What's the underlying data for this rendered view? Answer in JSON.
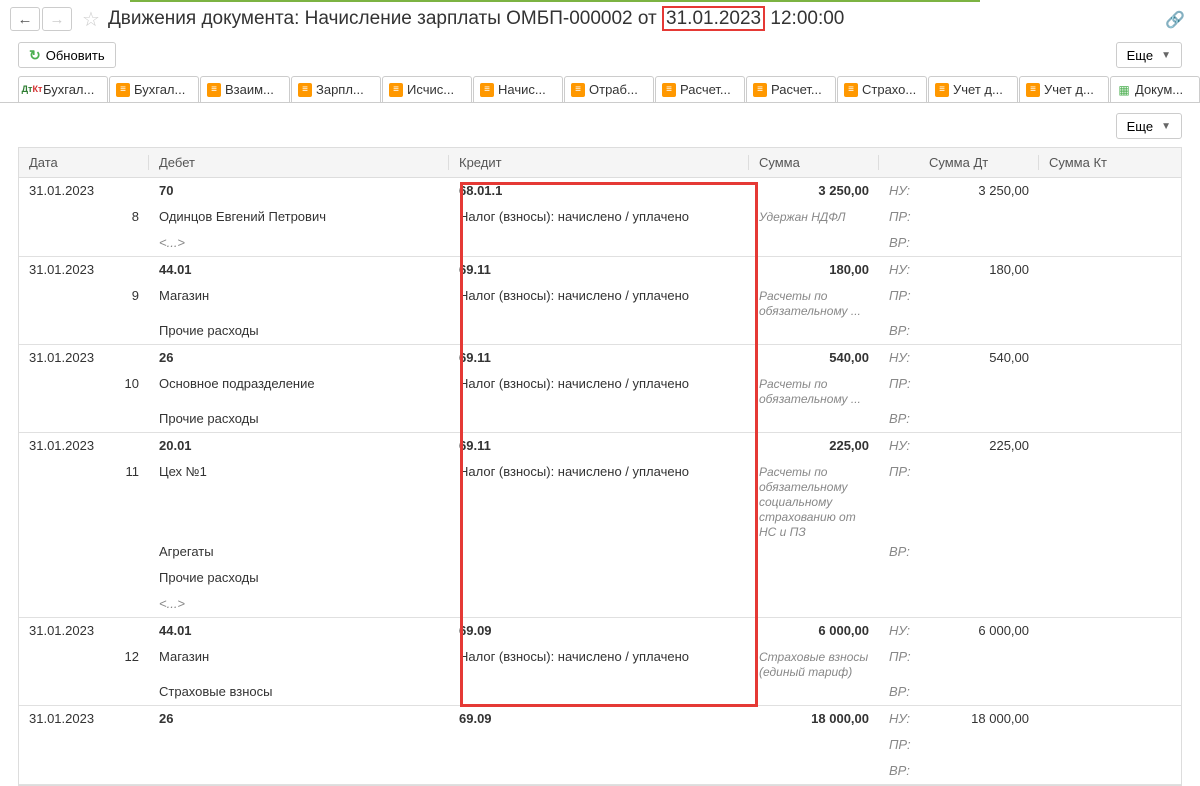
{
  "title_prefix": "Движения документа: Начисление зарплаты ОМБП-000002 от ",
  "title_date": "31.01.2023",
  "title_time": " 12:00:00",
  "refresh": "Обновить",
  "more": "Еще",
  "tabs": [
    {
      "label": "Бухгал...",
      "icon": "dtkt"
    },
    {
      "label": "Бухгал...",
      "icon": "orange"
    },
    {
      "label": "Взаим...",
      "icon": "orange"
    },
    {
      "label": "Зарпл...",
      "icon": "orange"
    },
    {
      "label": "Исчис...",
      "icon": "orange"
    },
    {
      "label": "Начис...",
      "icon": "orange"
    },
    {
      "label": "Отраб...",
      "icon": "orange"
    },
    {
      "label": "Расчет...",
      "icon": "orange"
    },
    {
      "label": "Расчет...",
      "icon": "orange"
    },
    {
      "label": "Страхо...",
      "icon": "orange"
    },
    {
      "label": "Учет д...",
      "icon": "orange"
    },
    {
      "label": "Учет д...",
      "icon": "orange"
    },
    {
      "label": "Докум...",
      "icon": "table"
    }
  ],
  "columns": {
    "date": "Дата",
    "debit": "Дебет",
    "credit": "Кредит",
    "sum": "Сумма",
    "sum_dt": "Сумма Дт",
    "sum_kt": "Сумма Кт"
  },
  "nu": "НУ:",
  "pr": "ПР:",
  "vr": "ВР:",
  "rows": [
    {
      "date": "31.01.2023",
      "num": "8",
      "debit_acc": "70",
      "debit_lines": [
        "Одинцов Евгений Петрович",
        "<...>"
      ],
      "credit_acc": "68.01.1",
      "credit_lines": [
        "Налог (взносы): начислено / уплачено"
      ],
      "sum": "3 250,00",
      "comment": "Удержан НДФЛ",
      "sum_dt": "3 250,00"
    },
    {
      "date": "31.01.2023",
      "num": "9",
      "debit_acc": "44.01",
      "debit_lines": [
        "Магазин",
        "Прочие расходы"
      ],
      "credit_acc": "69.11",
      "credit_lines": [
        "Налог (взносы): начислено / уплачено"
      ],
      "sum": "180,00",
      "comment": "Расчеты по обязательному ...",
      "sum_dt": "180,00"
    },
    {
      "date": "31.01.2023",
      "num": "10",
      "debit_acc": "26",
      "debit_lines": [
        "Основное подразделение",
        "Прочие расходы"
      ],
      "credit_acc": "69.11",
      "credit_lines": [
        "Налог (взносы): начислено / уплачено"
      ],
      "sum": "540,00",
      "comment": "Расчеты по обязательному ...",
      "sum_dt": "540,00"
    },
    {
      "date": "31.01.2023",
      "num": "11",
      "debit_acc": "20.01",
      "debit_lines": [
        "Цех №1",
        "Агрегаты",
        "Прочие расходы",
        "<...>"
      ],
      "credit_acc": "69.11",
      "credit_lines": [
        "Налог (взносы): начислено / уплачено"
      ],
      "sum": "225,00",
      "comment": "Расчеты по обязательному социальному страхованию от НС и ПЗ",
      "sum_dt": "225,00"
    },
    {
      "date": "31.01.2023",
      "num": "12",
      "debit_acc": "44.01",
      "debit_lines": [
        "Магазин",
        "Страховые взносы"
      ],
      "credit_acc": "69.09",
      "credit_lines": [
        "Налог (взносы): начислено / уплачено"
      ],
      "sum": "6 000,00",
      "comment": "Страховые взносы (единый тариф)",
      "sum_dt": "6 000,00"
    },
    {
      "date": "31.01.2023",
      "num": "",
      "debit_acc": "26",
      "debit_lines": [],
      "credit_acc": "69.09",
      "credit_lines": [],
      "sum": "18 000,00",
      "comment": "",
      "sum_dt": "18 000,00"
    }
  ]
}
